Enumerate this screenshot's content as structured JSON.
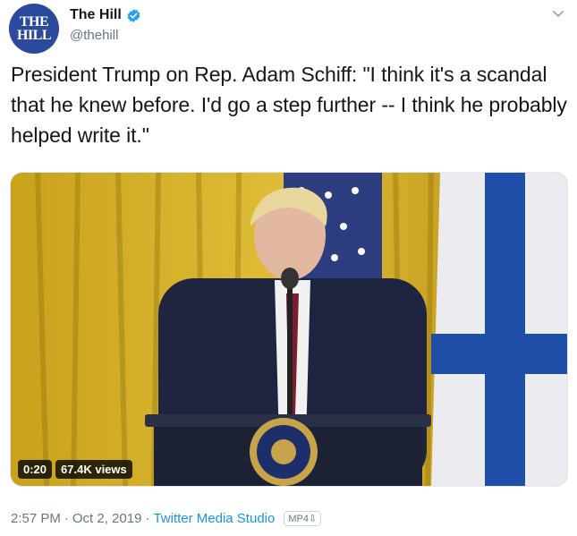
{
  "author": {
    "avatar_line1": "THE",
    "avatar_line2": "HILL",
    "display_name": "The Hill",
    "handle": "@thehill",
    "verified_icon": "verified-badge-icon"
  },
  "tweet": {
    "text": "President Trump on Rep. Adam Schiff: \"I think it's a scandal that he knew before. I'd go a step further -- I think he probably helped write it.\""
  },
  "media": {
    "duration": "0:20",
    "views": "67.4K views"
  },
  "meta": {
    "time": "2:57 PM",
    "date": "Oct 2, 2019",
    "separator": "·",
    "source": "Twitter Media Studio",
    "format_badge": "MP4⇩"
  },
  "colors": {
    "accent": "#1b95e0",
    "muted": "#657786",
    "verified": "#1da1f2",
    "avatar_bg": "#2b4a9b"
  }
}
